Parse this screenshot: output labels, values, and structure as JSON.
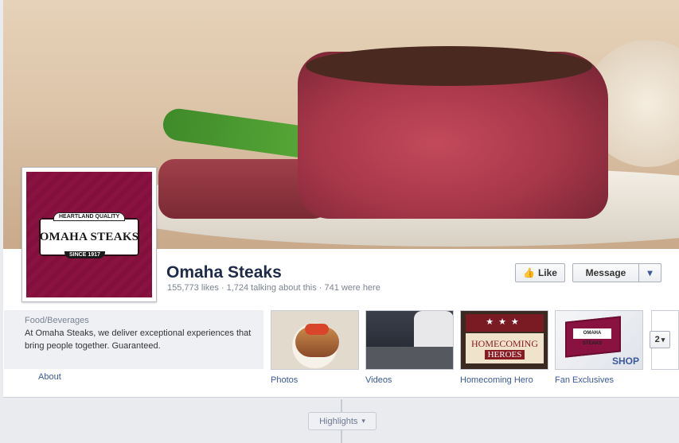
{
  "cover": {
    "alt": "cover-photo-steak"
  },
  "profile": {
    "logo_top": "HEARTLAND QUALITY",
    "logo_main": "OMAHA STEAKS",
    "logo_bottom": "SINCE 1917"
  },
  "page": {
    "name": "Omaha Steaks",
    "stats": "155,773 likes · 1,724 talking about this · 741 were here"
  },
  "actions": {
    "like_label": "Like",
    "message_label": "Message",
    "caret": "▾"
  },
  "about": {
    "category": "Food/Beverages",
    "description": "At Omaha Steaks, we deliver exceptional experiences that bring people together. Guaranteed.",
    "link": "About"
  },
  "apps": [
    {
      "label": "Photos"
    },
    {
      "label": "Videos"
    },
    {
      "label": "Homecoming Hero",
      "thumb_line1": "HOMECOMING",
      "thumb_line2": "HEROES",
      "stars": "★★★"
    },
    {
      "label": "Fan Exclusives",
      "thumb_shop": "SHOP"
    }
  ],
  "more_apps": {
    "count": "2",
    "caret": "▾"
  },
  "timeline": {
    "highlights_label": "Highlights",
    "caret": "▾"
  },
  "colors": {
    "link": "#3b5998",
    "brand": "#8a1240",
    "title": "#1d2a48"
  }
}
